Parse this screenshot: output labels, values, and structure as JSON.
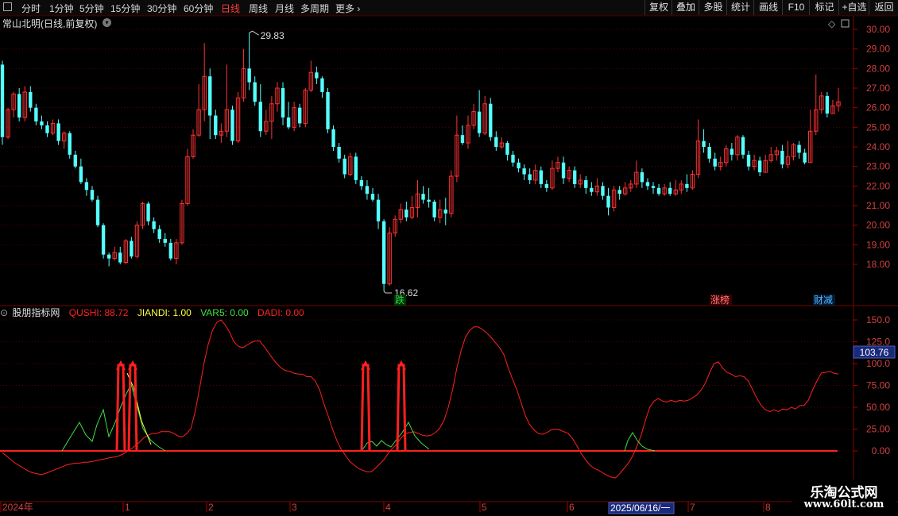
{
  "toolbar": {
    "periods": [
      "分时",
      "1分钟",
      "5分钟",
      "15分钟",
      "30分钟",
      "60分钟",
      "日线",
      "周线",
      "月线",
      "多周期",
      "更多"
    ],
    "active": "日线",
    "right_buttons": [
      "复权",
      "叠加",
      "多股",
      "统计",
      "画线",
      "F10",
      "标记",
      "+自选",
      "返回"
    ]
  },
  "main": {
    "title": "常山北明(日线,前复权)",
    "high_label": "29.83",
    "low_label": "16.62",
    "price_axis": [
      "30.00",
      "29.00",
      "28.00",
      "27.00",
      "26.00",
      "25.00",
      "24.00",
      "23.00",
      "22.00",
      "21.00",
      "20.00",
      "19.00",
      "18.00"
    ],
    "tags": [
      {
        "text": "跌",
        "color": "#2bd94a",
        "bg": "#003300"
      },
      {
        "text": "涨榜",
        "color": "#ff7a7a",
        "bg": "#3a0000"
      },
      {
        "text": "财减",
        "color": "#55b6ff",
        "bg": "#001b33"
      }
    ]
  },
  "indicator": {
    "name": "股朋指标网",
    "qushi_label": "QUSHI: 88.72",
    "jiandi_label": "JIANDI: 1.00",
    "var5_label": "VAR5: 0.00",
    "dadi_label": "DADI: 0.00",
    "axis": [
      "150.0",
      "125.0",
      "100.0",
      "75.00",
      "50.00",
      "25.00",
      "0.00"
    ],
    "current_value": "103.76"
  },
  "time_axis": {
    "labels": [
      "2024年",
      "1",
      "2",
      "3",
      "4",
      "5",
      "6",
      "7",
      "8"
    ],
    "cursor_date": "2025/06/16/一"
  },
  "watermark": {
    "line1": "乐淘公式网",
    "line2": "www.60lt.com"
  },
  "colors": {
    "up": "#ff3232",
    "down": "#54ffff",
    "qushi": "#ff2020",
    "jiandi": "#ffff40",
    "var5": "#40e040",
    "dadi": "#ff2020",
    "grid": "#5a0000"
  },
  "chart_data": {
    "type": "candlestick",
    "y_range": [
      16.5,
      30.3
    ],
    "candles": [
      [
        28.2,
        24.5,
        28.4,
        24.1
      ],
      [
        24.5,
        25.9,
        26.0,
        24.4
      ],
      [
        25.9,
        26.7,
        26.8,
        25.5
      ],
      [
        26.7,
        25.5,
        27.0,
        25.3
      ],
      [
        25.5,
        26.8,
        27.1,
        25.3
      ],
      [
        26.8,
        26.0,
        27.1,
        25.8
      ],
      [
        26.0,
        25.3,
        26.2,
        25.1
      ],
      [
        25.3,
        25.1,
        25.6,
        24.9
      ],
      [
        25.1,
        24.7,
        25.3,
        24.5
      ],
      [
        24.7,
        25.2,
        25.4,
        24.6
      ],
      [
        25.2,
        24.3,
        25.4,
        24.1
      ],
      [
        24.3,
        24.7,
        24.8,
        23.9
      ],
      [
        24.7,
        23.6,
        24.8,
        23.4
      ],
      [
        23.6,
        23.0,
        23.8,
        22.9
      ],
      [
        23.0,
        22.2,
        23.4,
        22.1
      ],
      [
        22.2,
        21.8,
        22.4,
        21.5
      ],
      [
        21.8,
        21.3,
        22.0,
        21.2
      ],
      [
        21.3,
        20.0,
        21.5,
        19.9
      ],
      [
        20.0,
        18.5,
        20.1,
        18.3
      ],
      [
        18.5,
        18.3,
        18.6,
        17.9
      ],
      [
        18.3,
        18.6,
        18.9,
        18.2
      ],
      [
        18.6,
        18.1,
        18.9,
        18.0
      ],
      [
        18.1,
        19.2,
        19.3,
        18.0
      ],
      [
        19.2,
        18.4,
        19.4,
        18.3
      ],
      [
        18.4,
        20.0,
        20.2,
        18.3
      ],
      [
        20.0,
        21.1,
        21.2,
        19.8
      ],
      [
        21.1,
        20.2,
        21.2,
        20.0
      ],
      [
        20.2,
        19.8,
        20.4,
        19.6
      ],
      [
        19.8,
        19.3,
        20.0,
        19.1
      ],
      [
        19.3,
        19.1,
        19.6,
        18.9
      ],
      [
        19.1,
        18.3,
        19.3,
        18.2
      ],
      [
        18.3,
        19.1,
        19.3,
        18.0
      ],
      [
        19.1,
        21.1,
        21.3,
        19.0
      ],
      [
        21.1,
        23.5,
        23.9,
        21.0
      ],
      [
        23.5,
        24.6,
        24.9,
        23.4
      ],
      [
        24.6,
        25.9,
        27.2,
        24.5
      ],
      [
        25.9,
        27.6,
        29.3,
        25.3
      ],
      [
        27.6,
        25.6,
        28.0,
        24.4
      ],
      [
        25.6,
        24.6,
        25.9,
        24.4
      ],
      [
        24.6,
        24.8,
        25.2,
        24.2
      ],
      [
        24.8,
        25.9,
        28.2,
        24.5
      ],
      [
        25.9,
        24.3,
        26.1,
        24.1
      ],
      [
        24.3,
        26.5,
        26.8,
        24.2
      ],
      [
        26.5,
        28.0,
        29.0,
        26.3
      ],
      [
        28.0,
        27.3,
        29.83,
        26.9
      ],
      [
        27.3,
        26.3,
        27.6,
        26.1
      ],
      [
        26.3,
        24.8,
        27.2,
        24.5
      ],
      [
        24.8,
        25.3,
        25.9,
        24.6
      ],
      [
        25.3,
        26.2,
        26.6,
        24.4
      ],
      [
        26.2,
        27.0,
        27.3,
        25.8
      ],
      [
        27.0,
        25.5,
        27.3,
        25.1
      ],
      [
        25.5,
        25.0,
        26.3,
        24.9
      ],
      [
        25.0,
        26.0,
        26.3,
        24.8
      ],
      [
        26.0,
        25.2,
        26.2,
        25.0
      ],
      [
        25.2,
        26.9,
        27.0,
        25.0
      ],
      [
        26.9,
        27.8,
        28.4,
        26.8
      ],
      [
        27.8,
        27.5,
        28.1,
        27.2
      ],
      [
        27.5,
        26.8,
        27.6,
        26.5
      ],
      [
        26.8,
        24.9,
        27.0,
        24.7
      ],
      [
        24.9,
        24.0,
        25.1,
        23.8
      ],
      [
        24.0,
        23.4,
        24.2,
        23.2
      ],
      [
        23.4,
        22.6,
        23.6,
        22.4
      ],
      [
        22.6,
        23.5,
        23.7,
        22.5
      ],
      [
        23.5,
        22.3,
        23.7,
        22.1
      ],
      [
        22.3,
        22.0,
        22.5,
        21.8
      ],
      [
        22.0,
        21.6,
        22.3,
        21.3
      ],
      [
        21.6,
        21.3,
        21.9,
        21.2
      ],
      [
        21.3,
        20.2,
        21.6,
        19.8
      ],
      [
        20.2,
        17.0,
        20.3,
        16.62
      ],
      [
        17.0,
        19.6,
        19.9,
        16.9
      ],
      [
        19.6,
        20.3,
        20.5,
        19.4
      ],
      [
        20.3,
        20.8,
        21.1,
        20.1
      ],
      [
        20.8,
        20.4,
        21.2,
        20.2
      ],
      [
        20.4,
        20.9,
        21.5,
        20.3
      ],
      [
        20.9,
        21.6,
        22.3,
        20.4
      ],
      [
        21.6,
        21.3,
        22.0,
        21.1
      ],
      [
        21.3,
        21.2,
        21.9,
        20.9
      ],
      [
        21.2,
        20.4,
        21.3,
        20.2
      ],
      [
        20.4,
        20.8,
        21.3,
        20.1
      ],
      [
        20.8,
        20.6,
        21.4,
        20.0
      ],
      [
        20.6,
        22.5,
        22.8,
        20.4
      ],
      [
        22.5,
        24.6,
        25.6,
        22.2
      ],
      [
        24.6,
        24.2,
        25.1,
        24.1
      ],
      [
        24.2,
        25.1,
        25.6,
        23.9
      ],
      [
        25.1,
        25.8,
        26.2,
        24.9
      ],
      [
        25.8,
        24.7,
        26.9,
        24.5
      ],
      [
        24.7,
        26.2,
        26.6,
        24.6
      ],
      [
        26.2,
        24.5,
        26.5,
        24.3
      ],
      [
        24.5,
        24.0,
        24.8,
        23.8
      ],
      [
        24.0,
        24.2,
        24.5,
        23.9
      ],
      [
        24.2,
        23.6,
        24.3,
        23.3
      ],
      [
        23.6,
        23.2,
        23.8,
        23.0
      ],
      [
        23.2,
        22.9,
        23.4,
        22.7
      ],
      [
        22.9,
        22.6,
        23.1,
        22.3
      ],
      [
        22.6,
        22.3,
        22.9,
        22.1
      ],
      [
        22.3,
        22.8,
        23.1,
        22.1
      ],
      [
        22.8,
        22.1,
        23.0,
        21.9
      ],
      [
        22.1,
        21.9,
        22.3,
        21.7
      ],
      [
        21.9,
        22.9,
        23.3,
        21.8
      ],
      [
        22.9,
        23.2,
        23.5,
        22.7
      ],
      [
        23.2,
        22.4,
        23.5,
        22.1
      ],
      [
        22.4,
        22.8,
        23.0,
        22.2
      ],
      [
        22.8,
        22.1,
        23.0,
        21.9
      ],
      [
        22.1,
        22.3,
        22.6,
        21.9
      ],
      [
        22.3,
        21.9,
        22.5,
        21.6
      ],
      [
        21.9,
        21.7,
        22.2,
        21.5
      ],
      [
        21.7,
        22.0,
        22.4,
        21.5
      ],
      [
        22.0,
        21.5,
        22.2,
        21.3
      ],
      [
        21.5,
        20.9,
        21.9,
        20.5
      ],
      [
        20.9,
        21.8,
        22.0,
        20.7
      ],
      [
        21.8,
        21.6,
        22.0,
        21.3
      ],
      [
        21.6,
        21.9,
        22.2,
        21.5
      ],
      [
        21.9,
        22.1,
        22.3,
        21.7
      ],
      [
        22.1,
        22.7,
        23.3,
        21.9
      ],
      [
        22.7,
        22.2,
        22.9,
        21.9
      ],
      [
        22.2,
        22.0,
        22.4,
        21.8
      ],
      [
        22.0,
        21.9,
        22.2,
        21.6
      ],
      [
        21.9,
        21.6,
        22.1,
        21.5
      ],
      [
        21.6,
        21.9,
        22.1,
        21.5
      ],
      [
        21.9,
        21.6,
        22.2,
        21.5
      ],
      [
        21.6,
        21.8,
        22.3,
        21.5
      ],
      [
        21.8,
        22.1,
        22.3,
        21.6
      ],
      [
        22.1,
        21.9,
        22.6,
        21.7
      ],
      [
        21.9,
        22.6,
        22.8,
        21.8
      ],
      [
        22.6,
        24.3,
        25.4,
        22.4
      ],
      [
        24.3,
        24.0,
        24.9,
        23.7
      ],
      [
        24.0,
        23.4,
        24.2,
        23.2
      ],
      [
        23.4,
        23.0,
        23.7,
        22.8
      ],
      [
        23.0,
        23.2,
        23.5,
        22.8
      ],
      [
        23.2,
        23.9,
        24.1,
        23.0
      ],
      [
        23.9,
        23.6,
        24.2,
        23.3
      ],
      [
        23.6,
        24.5,
        24.6,
        23.3
      ],
      [
        24.5,
        23.6,
        24.6,
        23.4
      ],
      [
        23.6,
        23.0,
        23.8,
        22.8
      ],
      [
        23.0,
        23.3,
        23.6,
        22.8
      ],
      [
        23.3,
        22.7,
        23.5,
        22.5
      ],
      [
        22.7,
        23.3,
        23.6,
        22.7
      ],
      [
        23.3,
        23.6,
        24.0,
        23.2
      ],
      [
        23.6,
        23.8,
        24.0,
        23.3
      ],
      [
        23.8,
        23.1,
        24.1,
        22.9
      ],
      [
        23.1,
        23.5,
        24.3,
        22.9
      ],
      [
        23.5,
        24.1,
        24.2,
        23.3
      ],
      [
        24.1,
        23.7,
        24.3,
        23.4
      ],
      [
        23.7,
        23.2,
        23.9,
        23.1
      ],
      [
        23.2,
        24.8,
        25.9,
        23.2
      ],
      [
        24.8,
        25.9,
        27.7,
        24.6
      ],
      [
        25.9,
        26.6,
        26.8,
        25.7
      ],
      [
        26.6,
        25.7,
        26.8,
        25.5
      ],
      [
        25.7,
        26.1,
        26.4,
        25.7
      ],
      [
        26.1,
        26.3,
        27.0,
        25.8
      ]
    ],
    "indicator": {
      "y_range": [
        -10,
        160
      ],
      "qushi": [
        -2,
        -6,
        -10,
        -14,
        -17,
        -20,
        -23,
        -25,
        -26,
        -27,
        -26,
        -24,
        -22,
        -20,
        -18,
        -16,
        -15,
        -14,
        -14,
        -13,
        -13,
        -12,
        -11,
        -10,
        -9,
        -8,
        -7,
        -6,
        -4,
        -1,
        2,
        6,
        10,
        15,
        18,
        20,
        20,
        22,
        22,
        22,
        20,
        17,
        16,
        20,
        26,
        46,
        72,
        100,
        122,
        138,
        147,
        150,
        144,
        136,
        125,
        120,
        118,
        121,
        124,
        126,
        126,
        120,
        113,
        106,
        100,
        95,
        92,
        91,
        89,
        88,
        88,
        85,
        85,
        80,
        70,
        54,
        40,
        25,
        12,
        2,
        -5,
        -12,
        -16,
        -20,
        -22,
        -24,
        -24,
        -20,
        -15,
        -10,
        -3,
        3,
        8,
        15,
        20,
        21,
        22,
        20,
        18,
        17,
        18,
        21,
        26,
        35,
        50,
        70,
        95,
        115,
        130,
        138,
        142,
        142,
        139,
        135,
        130,
        124,
        118,
        110,
        95,
        82,
        70,
        55,
        40,
        30,
        24,
        20,
        19,
        21,
        24,
        25,
        24,
        22,
        20,
        14,
        6,
        -3,
        -10,
        -16,
        -20,
        -22,
        -25,
        -28,
        -30,
        -31,
        -26,
        -20,
        -14,
        -6,
        5,
        18,
        35,
        50,
        57,
        60,
        57,
        56,
        58,
        56,
        58,
        57,
        58,
        61,
        64,
        70,
        78,
        90,
        100,
        102,
        95,
        90,
        88,
        85,
        86,
        85,
        80,
        70,
        60,
        52,
        47,
        45,
        47,
        45,
        48,
        47,
        50,
        48,
        52,
        52,
        58,
        70,
        80,
        89,
        90,
        91,
        89,
        88
      ]
    }
  }
}
